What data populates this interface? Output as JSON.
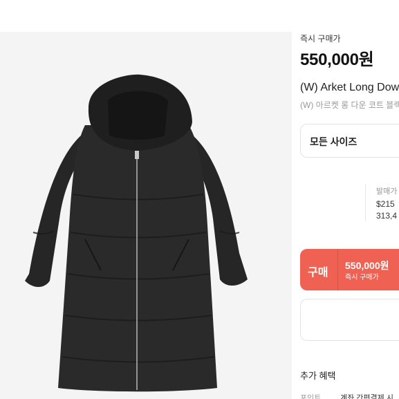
{
  "price_section": {
    "label": "즉시 구매가",
    "price": "550,000원"
  },
  "product": {
    "name_en": "(W) Arket Long Down Coat",
    "name_ko": "(W) 아르켓 롱 다운 코트 블랙"
  },
  "size_selector": {
    "label": "모든 사이즈"
  },
  "release_price": {
    "label": "발매가",
    "usd": "$215",
    "krw": "313,4"
  },
  "buy_button": {
    "label": "구매",
    "price": "550,000원",
    "sub_label": "즉시 구매가",
    "color": "#ef6253"
  },
  "benefits": {
    "heading": "추가 혜택",
    "point_label": "포인트",
    "point_value": "계좌 간편결제 시"
  }
}
